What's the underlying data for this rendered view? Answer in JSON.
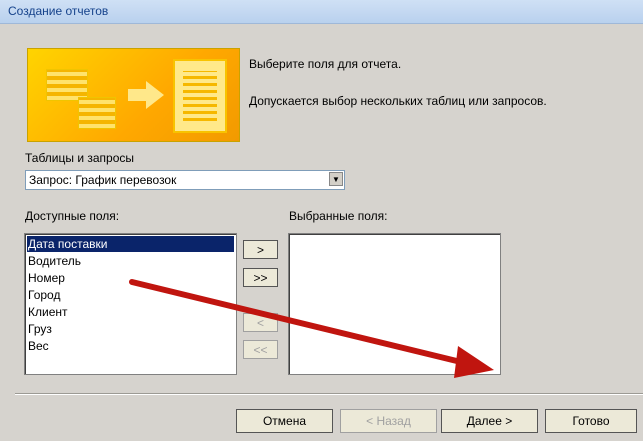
{
  "window": {
    "title": "Создание отчетов"
  },
  "intro": {
    "line1": "Выберите поля для отчета.",
    "line2": "Допускается выбор нескольких таблиц или запросов."
  },
  "tables_label": "Таблицы и запросы",
  "query_select": {
    "value": "Запрос: График перевозок",
    "icon": "chevron-down-icon"
  },
  "available_label": "Доступные поля:",
  "selected_label": "Выбранные поля:",
  "available_fields": [
    "Дата поставки",
    "Водитель",
    "Номер",
    "Город",
    "Клиент",
    "Груз",
    "Вес"
  ],
  "selected_index": 0,
  "move_buttons": {
    "add_one": ">",
    "add_all": ">>",
    "remove_one": "<",
    "remove_all": "<<"
  },
  "footer": {
    "cancel": "Отмена",
    "back": "< Назад",
    "next": "Далее >",
    "finish": "Готово"
  },
  "annotation_color": "#c0150f"
}
